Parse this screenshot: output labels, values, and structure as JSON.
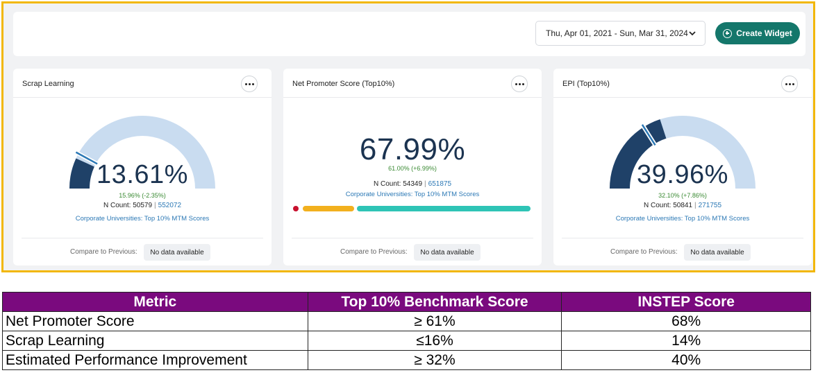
{
  "toolbar": {
    "date_range": "Thu, Apr 01, 2021 - Sun, Mar 31, 2024",
    "create_widget_label": "Create Widget"
  },
  "widgets": [
    {
      "title": "Scrap Learning",
      "value": "13.61%",
      "gauge_fraction": 0.1361,
      "benchmark_fraction": 0.1596,
      "benchmark_text": "15.96% (-2.35%)",
      "ncount_label": "N Count: 50579",
      "ncount_total": "552072",
      "benchmark_name": "Corporate Universities: Top 10% MTM Scores",
      "compare_label": "Compare to Previous:",
      "compare_value": "No data available"
    },
    {
      "title": "Net Promoter Score (Top10%)",
      "value": "67.99%",
      "benchmark_text": "61.00% (+6.99%)",
      "ncount_label": "N Count: 54349",
      "ncount_total": "651875",
      "benchmark_name": "Corporate Universities: Top 10% MTM Scores",
      "compare_label": "Compare to Previous:",
      "compare_value": "No data available"
    },
    {
      "title": "EPI (Top10%)",
      "value": "39.96%",
      "gauge_fraction": 0.3996,
      "benchmark_fraction": 0.321,
      "benchmark_text": "32.10% (+7.86%)",
      "ncount_label": "N Count: 50841",
      "ncount_total": "271755",
      "benchmark_name": "Corporate Universities: Top 10% MTM Scores",
      "compare_label": "Compare to Previous:",
      "compare_value": "No data available"
    }
  ],
  "colors": {
    "gauge_fill": "#1f4168",
    "gauge_track": "#c9dcf0",
    "accent_teal": "#14776b",
    "bar_red": "#c8102e",
    "bar_yellow": "#f2b01e",
    "bar_teal": "#2ec4b6",
    "header_purple": "#7a0a7e",
    "frame_yellow": "#f2b705"
  },
  "table": {
    "headers": [
      "Metric",
      "Top 10% Benchmark Score",
      "INSTEP Score"
    ],
    "rows": [
      [
        "Net Promoter Score",
        "≥ 61%",
        "68%"
      ],
      [
        "Scrap Learning",
        "≤16%",
        "14%"
      ],
      [
        "Estimated Performance Improvement",
        "≥ 32%",
        "40%"
      ]
    ]
  }
}
